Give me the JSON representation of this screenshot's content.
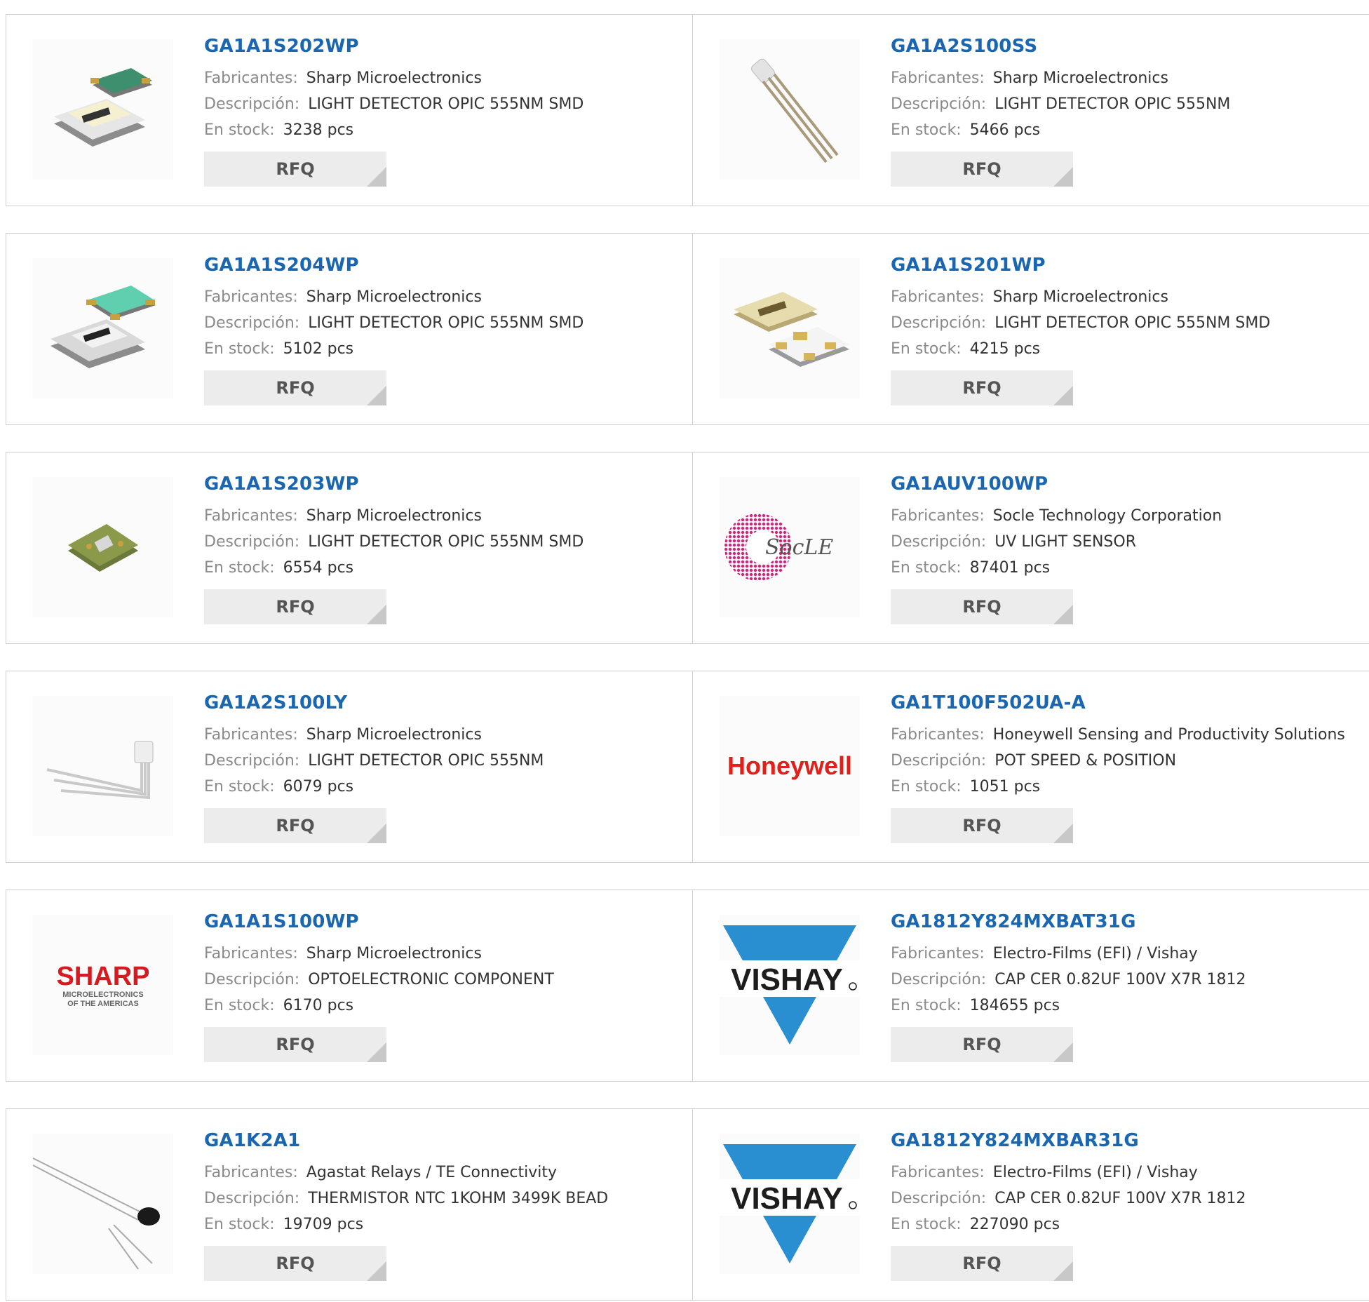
{
  "labels": {
    "manufacturer": "Fabricantes:",
    "description": "Descripción:",
    "stock": "En stock:",
    "rfq": "RFQ"
  },
  "products": [
    {
      "part": "GA1A1S202WP",
      "manufacturer": "Sharp Microelectronics",
      "description": "LIGHT DETECTOR OPIC 555NM SMD",
      "stock": "3238 pcs",
      "image": "smd-sensor-green-icon"
    },
    {
      "part": "GA1A2S100SS",
      "manufacturer": "Sharp Microelectronics",
      "description": "LIGHT DETECTOR OPIC 555NM",
      "stock": "5466 pcs",
      "image": "through-hole-sensor-icon"
    },
    {
      "part": "GA1A1S204WP",
      "manufacturer": "Sharp Microelectronics",
      "description": "LIGHT DETECTOR OPIC 555NM SMD",
      "stock": "5102 pcs",
      "image": "smd-sensor-teal-icon"
    },
    {
      "part": "GA1A1S201WP",
      "manufacturer": "Sharp Microelectronics",
      "description": "LIGHT DETECTOR OPIC 555NM SMD",
      "stock": "4215 pcs",
      "image": "smd-sensor-gold-icon"
    },
    {
      "part": "GA1A1S203WP",
      "manufacturer": "Sharp Microelectronics",
      "description": "LIGHT DETECTOR OPIC 555NM SMD",
      "stock": "6554 pcs",
      "image": "small-smd-chip-icon"
    },
    {
      "part": "GA1AUV100WP",
      "manufacturer": "Socle Technology Corporation",
      "description": "UV LIGHT SENSOR",
      "stock": "87401 pcs",
      "image": "socle-logo",
      "logo_text": "SocLE"
    },
    {
      "part": "GA1A2S100LY",
      "manufacturer": "Sharp Microelectronics",
      "description": "LIGHT DETECTOR OPIC 555NM",
      "stock": "6079 pcs",
      "image": "right-angle-sensor-icon"
    },
    {
      "part": "GA1T100F502UA-A",
      "manufacturer": "Honeywell Sensing and Productivity Solutions",
      "description": "POT SPEED & POSITION",
      "stock": "1051 pcs",
      "image": "honeywell-logo",
      "logo_text": "Honeywell"
    },
    {
      "part": "GA1A1S100WP",
      "manufacturer": "Sharp Microelectronics",
      "description": "OPTOELECTRONIC COMPONENT",
      "stock": "6170 pcs",
      "image": "sharp-logo",
      "logo_text": "SHARP",
      "logo_sub1": "MICROELECTRONICS",
      "logo_sub2": "OF THE AMERICAS"
    },
    {
      "part": "GA1812Y824MXBAT31G",
      "manufacturer": "Electro-Films (EFI) / Vishay",
      "description": "CAP CER 0.82UF 100V X7R 1812",
      "stock": "184655 pcs",
      "image": "vishay-logo",
      "logo_text": "VISHAY"
    },
    {
      "part": "GA1K2A1",
      "manufacturer": "Agastat Relays / TE Connectivity",
      "description": "THERMISTOR NTC 1KOHM 3499K BEAD",
      "stock": "19709 pcs",
      "image": "thermistor-bead-icon"
    },
    {
      "part": "GA1812Y824MXBAR31G",
      "manufacturer": "Electro-Films (EFI) / Vishay",
      "description": "CAP CER 0.82UF 100V X7R 1812",
      "stock": "227090 pcs",
      "image": "vishay-logo",
      "logo_text": "VISHAY"
    }
  ]
}
